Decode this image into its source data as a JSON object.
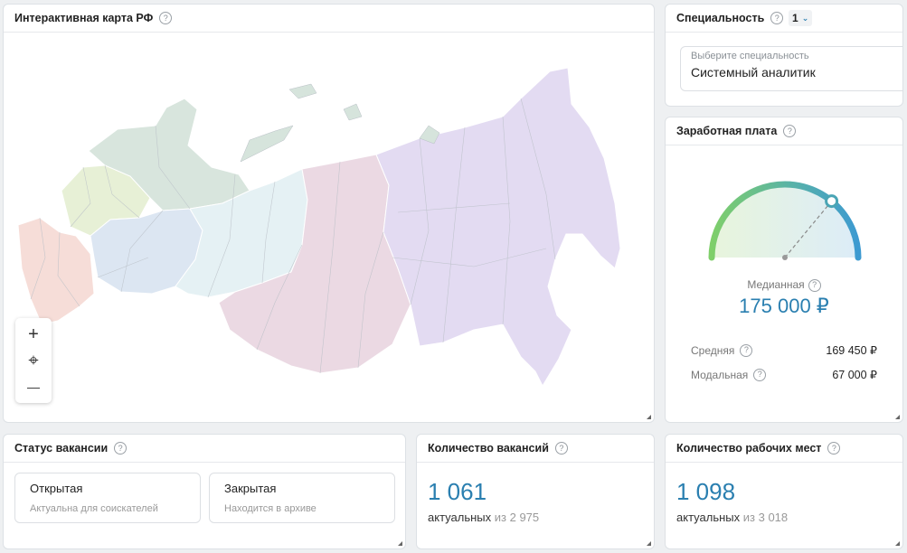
{
  "map": {
    "title": "Интерактивная карта РФ",
    "zoom_in": "+",
    "locate": "⌖",
    "zoom_out": "—"
  },
  "speciality": {
    "title": "Специальность",
    "count_badge": "1",
    "field_placeholder": "Выберите специальность",
    "field_value": "Системный аналитик"
  },
  "salary": {
    "title": "Заработная плата",
    "median_label": "Медианная",
    "median_value": "175 000 ₽",
    "average_label": "Средняя",
    "average_value": "169 450 ₽",
    "mode_label": "Модальная",
    "mode_value": "67 000 ₽",
    "gauge_fraction": 0.72
  },
  "status": {
    "title": "Статус вакансии",
    "cards": [
      {
        "title": "Открытая",
        "subtitle": "Актуальна для соискателей"
      },
      {
        "title": "Закрытая",
        "subtitle": "Находится в архиве"
      }
    ]
  },
  "vacancies": {
    "title": "Количество вакансий",
    "value": "1 061",
    "active_label": "актуальных",
    "of_label": "из 2 975"
  },
  "workplaces": {
    "title": "Количество рабочих мест",
    "value": "1 098",
    "active_label": "актуальных",
    "of_label": "из 3 018"
  },
  "colors": {
    "accent": "#2a7fb0",
    "gauge_start": "#7fcf6a",
    "gauge_end": "#3d9ad1"
  }
}
